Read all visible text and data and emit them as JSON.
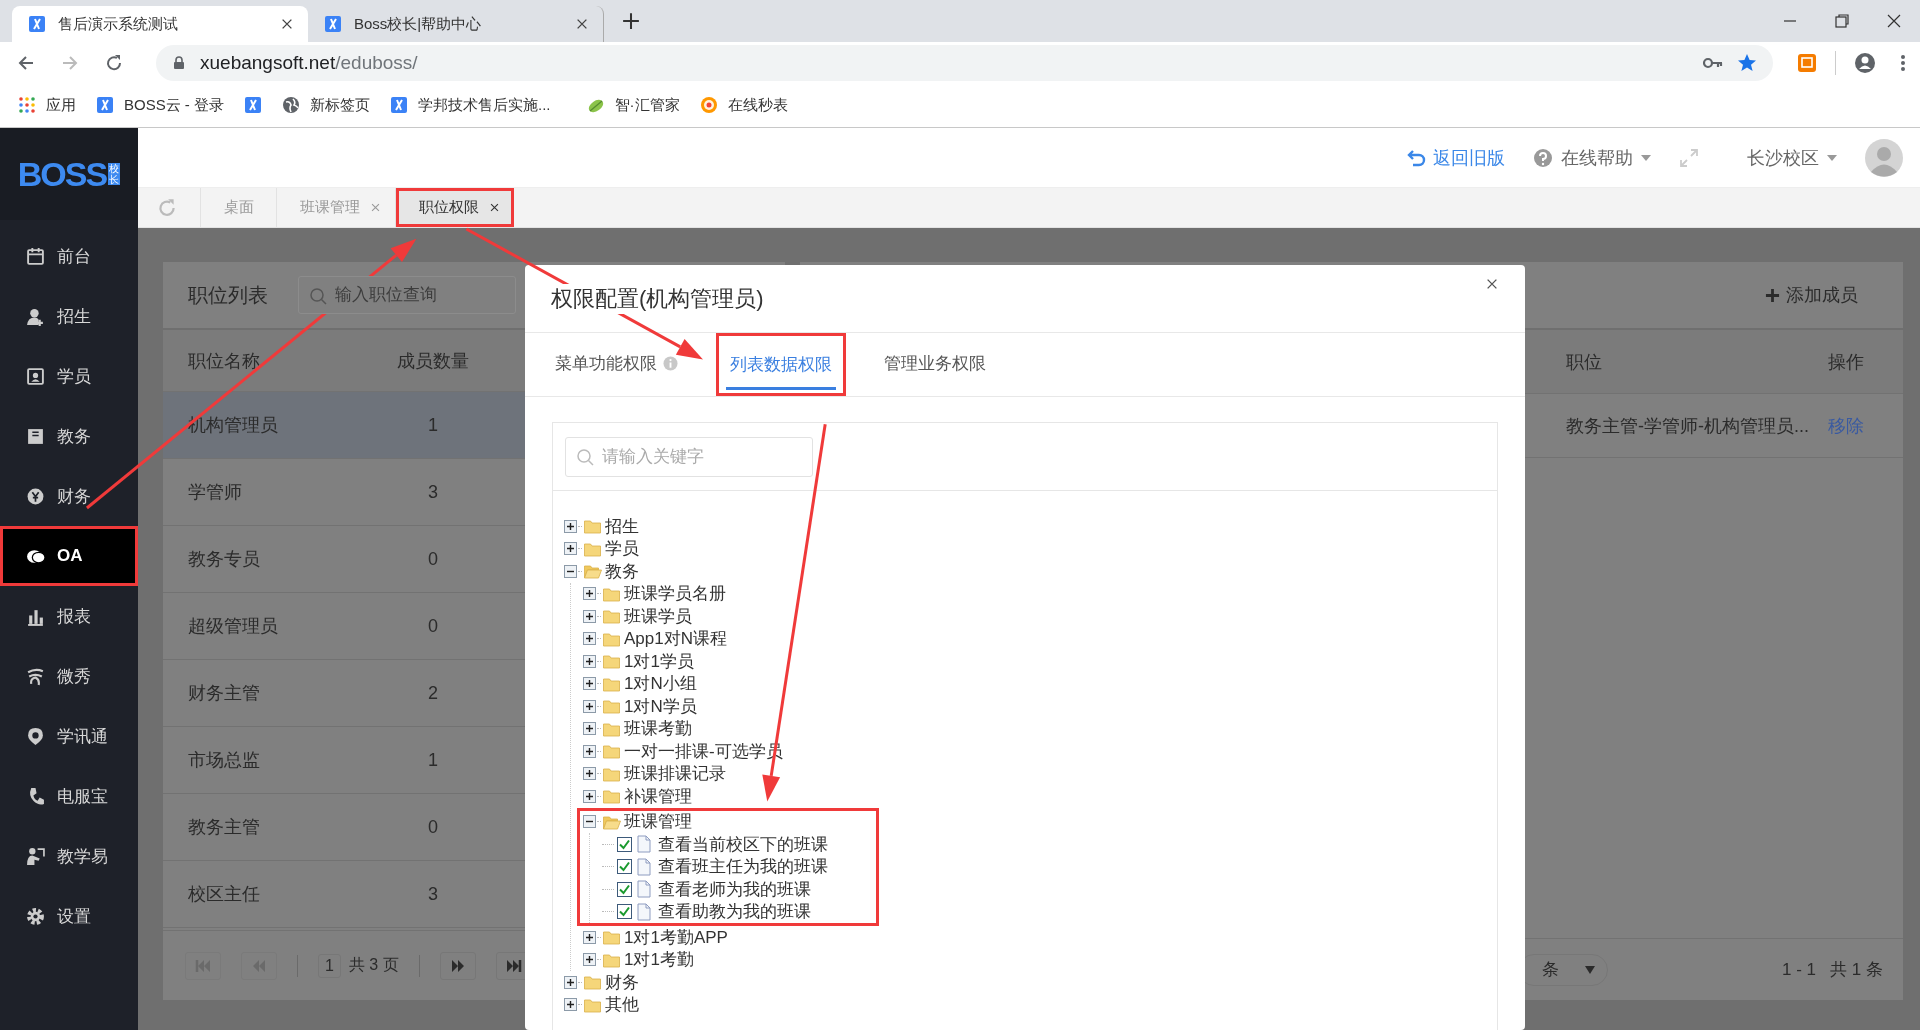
{
  "browser": {
    "tabs": [
      {
        "title": "售后演示系统测试",
        "selected": true
      },
      {
        "title": "Boss校长|帮助中心",
        "selected": false
      }
    ],
    "url": {
      "host": "xuebangsoft.net",
      "path": "/eduboss/"
    },
    "bookmarks": [
      {
        "kind": "apps",
        "label": "应用"
      },
      {
        "kind": "x",
        "label": "BOSS云 - 登录"
      },
      {
        "kind": "x"
      },
      {
        "kind": "globe",
        "label": "新标签页"
      },
      {
        "kind": "x",
        "label": "学邦技术售后实施..."
      },
      {
        "kind": "leaf",
        "label": "智·汇管家"
      },
      {
        "kind": "swirl",
        "label": "在线秒表"
      }
    ]
  },
  "logo": {
    "text": "BOSS",
    "badge": "校长"
  },
  "header": {
    "back_link": "返回旧版",
    "help": "在线帮助",
    "campus": "长沙校区"
  },
  "sidebar": [
    {
      "kind": "calendar",
      "label": "前台",
      "selected": false,
      "highlighted": false
    },
    {
      "kind": "user-plus",
      "label": "招生",
      "selected": false,
      "highlighted": false
    },
    {
      "kind": "id-card",
      "label": "学员",
      "selected": false,
      "highlighted": false
    },
    {
      "kind": "book",
      "label": "教务",
      "selected": false,
      "highlighted": false
    },
    {
      "kind": "coin",
      "label": "财务",
      "selected": false,
      "highlighted": false
    },
    {
      "kind": "chat",
      "label": "OA",
      "selected": true,
      "highlighted": true
    },
    {
      "kind": "chart",
      "label": "报表",
      "selected": false,
      "highlighted": false
    },
    {
      "kind": "wave",
      "label": "微秀",
      "selected": false,
      "highlighted": false
    },
    {
      "kind": "pin",
      "label": "学讯通",
      "selected": false,
      "highlighted": false
    },
    {
      "kind": "phone",
      "label": "电服宝",
      "selected": false,
      "highlighted": false
    },
    {
      "kind": "teacher",
      "label": "教学易",
      "selected": false,
      "highlighted": false
    },
    {
      "kind": "gear",
      "label": "设置",
      "selected": false,
      "highlighted": false
    }
  ],
  "page_tabs": [
    {
      "label": "桌面",
      "selected": false,
      "closable": false,
      "highlighted": false
    },
    {
      "label": "班课管理",
      "selected": false,
      "closable": true,
      "highlighted": false
    },
    {
      "label": "职位权限",
      "selected": true,
      "closable": true,
      "highlighted": true
    }
  ],
  "positions_panel": {
    "title": "职位列表",
    "search": {
      "placeholder": "输入职位查询"
    },
    "columns": [
      "职位名称",
      "成员数量"
    ],
    "rows": [
      {
        "name": "机构管理员",
        "count": "1",
        "selected": true
      },
      {
        "name": "学管师",
        "count": "3",
        "selected": false
      },
      {
        "name": "教务专员",
        "count": "0",
        "selected": false
      },
      {
        "name": "超级管理员",
        "count": "0",
        "selected": false
      },
      {
        "name": "财务主管",
        "count": "2",
        "selected": false
      },
      {
        "name": "市场总监",
        "count": "1",
        "selected": false
      },
      {
        "name": "教务主管",
        "count": "0",
        "selected": false
      },
      {
        "name": "校区主任",
        "count": "3",
        "selected": false
      }
    ],
    "pager": {
      "buttons": [
        {
          "kind": "first",
          "disabled": true
        },
        {
          "kind": "prev",
          "disabled": true
        },
        {
          "kind": "next",
          "disabled": false
        },
        {
          "kind": "last",
          "disabled": false
        }
      ],
      "page": "1",
      "total": "共 3 页"
    }
  },
  "members_panel": {
    "add_button": "添加成员",
    "columns": [
      "职位",
      "操作"
    ],
    "rows": [
      {
        "position": "教务主管-学管师-机构管理员...",
        "action": "移除"
      }
    ],
    "footer": {
      "page_size": "条",
      "range": "1 - 1",
      "total": "共 1 条"
    }
  },
  "dialog": {
    "title": "权限配置(机构管理员)",
    "tabs": [
      {
        "label": "菜单功能权限",
        "selected": false,
        "info": true,
        "highlighted": false
      },
      {
        "label": "列表数据权限",
        "selected": true,
        "info": false,
        "highlighted": true
      },
      {
        "label": "管理业务权限",
        "selected": false,
        "info": false,
        "highlighted": false
      }
    ],
    "search": {
      "placeholder": "请输入关键字"
    },
    "tree": [
      {
        "kind": "folder",
        "label": "招生",
        "expanded": false
      },
      {
        "kind": "folder",
        "label": "学员",
        "expanded": false
      },
      {
        "kind": "folder",
        "label": "教务",
        "expanded": true,
        "children": [
          {
            "kind": "folder",
            "label": "班课学员名册",
            "expanded": false
          },
          {
            "kind": "folder",
            "label": "班课学员",
            "expanded": false
          },
          {
            "kind": "folder",
            "label": "App1对N课程",
            "expanded": false
          },
          {
            "kind": "folder",
            "label": "1对1学员",
            "expanded": false
          },
          {
            "kind": "folder",
            "label": "1对N小组",
            "expanded": false
          },
          {
            "kind": "folder",
            "label": "1对N学员",
            "expanded": false
          },
          {
            "kind": "folder",
            "label": "班课考勤",
            "expanded": false
          },
          {
            "kind": "folder",
            "label": "一对一排课-可选学员",
            "expanded": false
          },
          {
            "kind": "folder",
            "label": "班课排课记录",
            "expanded": false
          },
          {
            "kind": "folder",
            "label": "补课管理",
            "expanded": false
          },
          {
            "kind": "folder",
            "label": "班课管理",
            "expanded": true,
            "highlighted": true,
            "children": [
              {
                "kind": "item",
                "label": "查看当前校区下的班课",
                "checked": true
              },
              {
                "kind": "item",
                "label": "查看班主任为我的班课",
                "checked": true
              },
              {
                "kind": "item",
                "label": "查看老师为我的班课",
                "checked": true
              },
              {
                "kind": "item",
                "label": "查看助教为我的班课",
                "checked": true
              }
            ]
          },
          {
            "kind": "folder",
            "label": "1对1考勤APP",
            "expanded": false
          },
          {
            "kind": "folder",
            "label": "1对1考勤",
            "expanded": false
          }
        ]
      },
      {
        "kind": "folder",
        "label": "财务",
        "expanded": false
      },
      {
        "kind": "folder",
        "label": "其他",
        "expanded": false
      }
    ]
  }
}
